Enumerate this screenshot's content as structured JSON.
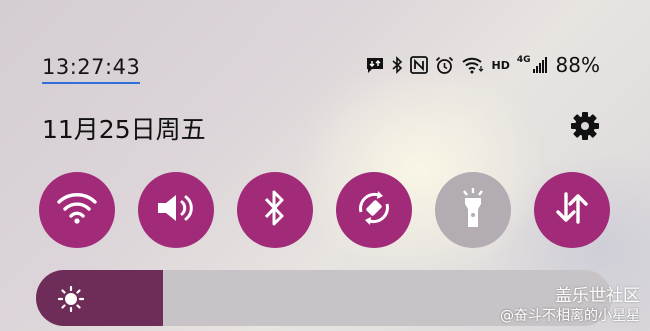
{
  "status_bar": {
    "time": "13:27:43",
    "network_type": "HD",
    "cellular_generation": "4G",
    "battery": "88%",
    "icons": [
      "message-notification-icon",
      "bluetooth-icon",
      "nfc-icon",
      "alarm-icon",
      "wifi-icon",
      "hd-icon",
      "cellular-signal-icon"
    ]
  },
  "header": {
    "date": "11月25日周五",
    "settings_icon": "gear-icon"
  },
  "quick_tiles": [
    {
      "name": "wifi",
      "icon": "wifi-icon",
      "state": "on"
    },
    {
      "name": "sound",
      "icon": "speaker-icon",
      "state": "on"
    },
    {
      "name": "bluetooth",
      "icon": "bluetooth-icon",
      "state": "on"
    },
    {
      "name": "auto-rotate",
      "icon": "rotate-icon",
      "state": "on"
    },
    {
      "name": "flashlight",
      "icon": "flashlight-icon",
      "state": "off"
    },
    {
      "name": "mobile-data",
      "icon": "data-transfer-icon",
      "state": "on"
    }
  ],
  "brightness": {
    "level": 0.22,
    "icon": "sun-icon"
  },
  "colors": {
    "accent": "#a12b79",
    "tile_off": "#b3acb2",
    "brightness_fill": "#6e2c58",
    "underline": "#2f6fd6"
  },
  "watermark": {
    "brand": "盖乐世社区",
    "author": "@奋斗不相离的小星星"
  }
}
